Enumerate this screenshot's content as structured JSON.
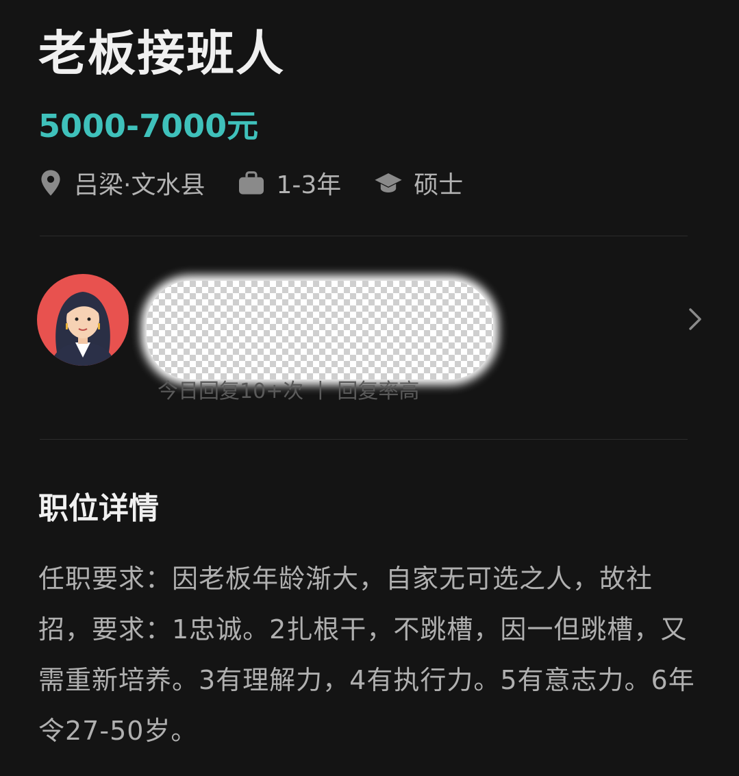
{
  "job": {
    "title": "老板接班人",
    "salary": "5000-7000元",
    "location": "吕梁·文水县",
    "experience": "1-3年",
    "education": "硕士",
    "icons": {
      "location": "location-pin-icon",
      "experience": "briefcase-icon",
      "education": "graduation-cap-icon"
    }
  },
  "recruiter": {
    "reply_stats": "今日回复10+次 丨 回复率高",
    "avatar_icon": "avatar-illustration",
    "chevron_icon": "chevron-right-icon"
  },
  "details": {
    "section_title": "职位详情",
    "description": "任职要求：因老板年龄渐大，自家无可选之人，故社招，要求：1忠诚。2扎根干，不跳槽，因一但跳槽，又需重新培养。3有理解力，4有执行力。5有意志力。6年令27-50岁。"
  },
  "colors": {
    "background": "#141414",
    "accent": "#3fc1bb",
    "avatar_bg": "#e8524f"
  }
}
